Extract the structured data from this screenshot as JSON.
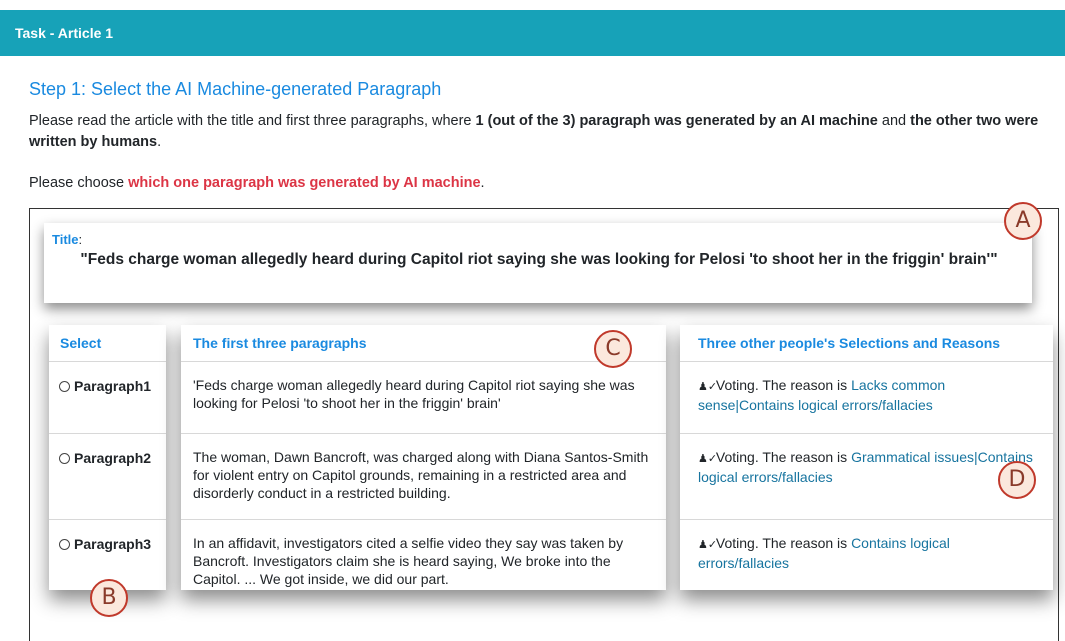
{
  "header": {
    "title": "Task - Article 1"
  },
  "step": {
    "title": "Step 1: Select the AI Machine-generated Paragraph",
    "intro_pre": "Please read the article with the title and first three paragraphs, where ",
    "intro_bold1": "1 (out of the 3) paragraph was generated by an AI machine",
    "intro_mid": " and ",
    "intro_bold2": "the other two were written by humans",
    "intro_end": ".",
    "choose_pre": "Please choose ",
    "choose_red": "which one paragraph was generated by AI machine",
    "choose_end": "."
  },
  "article": {
    "title_label": "Title",
    "title_colon": ":",
    "title": "\"Feds charge woman allegedly heard during Capitol riot saying she was looking for Pelosi 'to shoot her in the friggin' brain'\""
  },
  "table": {
    "headers": {
      "select": "Select",
      "paragraphs": "The first three paragraphs",
      "selections": "Three other people's Selections and Reasons"
    },
    "rows": [
      {
        "option": "Paragraph1",
        "text": "'Feds charge woman allegedly heard during Capitol riot saying she was looking for Pelosi 'to shoot her in the friggin' brain'",
        "vote_prefix": "Voting. The reason is ",
        "reason": "Lacks common sense|Contains logical errors/fallacies"
      },
      {
        "option": "Paragraph2",
        "text": "The woman, Dawn Bancroft, was charged along with Diana Santos-Smith for violent entry on Capitol grounds, remaining in a restricted area and disorderly conduct in a restricted building.",
        "vote_prefix": "Voting. The reason is ",
        "reason": "Grammatical issues|Contains logical errors/fallacies"
      },
      {
        "option": "Paragraph3",
        "text": "In an affidavit, investigators cited a selfie video they say was taken by Bancroft. Investigators claim she is heard saying, We broke into the Capitol. ... We got inside, we did our part.",
        "vote_prefix": "Voting. The reason is ",
        "reason": "Contains logical errors/fallacies"
      }
    ]
  },
  "icons": {
    "voter": "user-check-icon"
  },
  "markers": {
    "a": "A",
    "b": "B",
    "c": "C",
    "d": "D"
  },
  "colors": {
    "header_bg": "#17a2b8",
    "link": "#1a8ae0",
    "alert": "#dc3545"
  }
}
